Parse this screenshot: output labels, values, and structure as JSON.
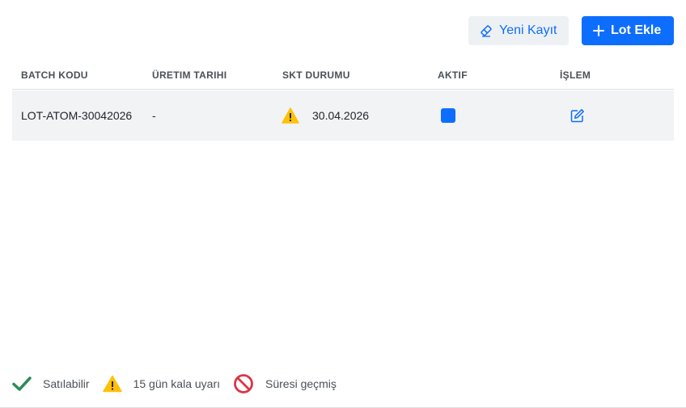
{
  "toolbar": {
    "new_record_label": "Yeni Kayıt",
    "add_lot_label": "Lot Ekle"
  },
  "table": {
    "columns": [
      "BATCH KODU",
      "ÜRETIM TARIHI",
      "SKT DURUMU",
      "AKTIF",
      "İŞLEM"
    ],
    "rows": [
      {
        "batch_code": "LOT-ATOM-30042026",
        "production_date": "-",
        "expiry_date": "30.04.2026",
        "expiry_status_icon": "warning-icon",
        "active": true
      }
    ]
  },
  "legend": {
    "items": [
      {
        "icon": "check-icon",
        "label": "Satılabilir",
        "color": "#2e8b57"
      },
      {
        "icon": "warning-icon",
        "label": "15 gün kala uyarı",
        "color": "#ffc107"
      },
      {
        "icon": "prohibited-icon",
        "label": "Süresi geçmiş",
        "color": "#dc3545"
      }
    ]
  },
  "colors": {
    "primary": "#0d6efd",
    "warning": "#ffc107",
    "success": "#2e8b57",
    "danger": "#dc3545"
  }
}
